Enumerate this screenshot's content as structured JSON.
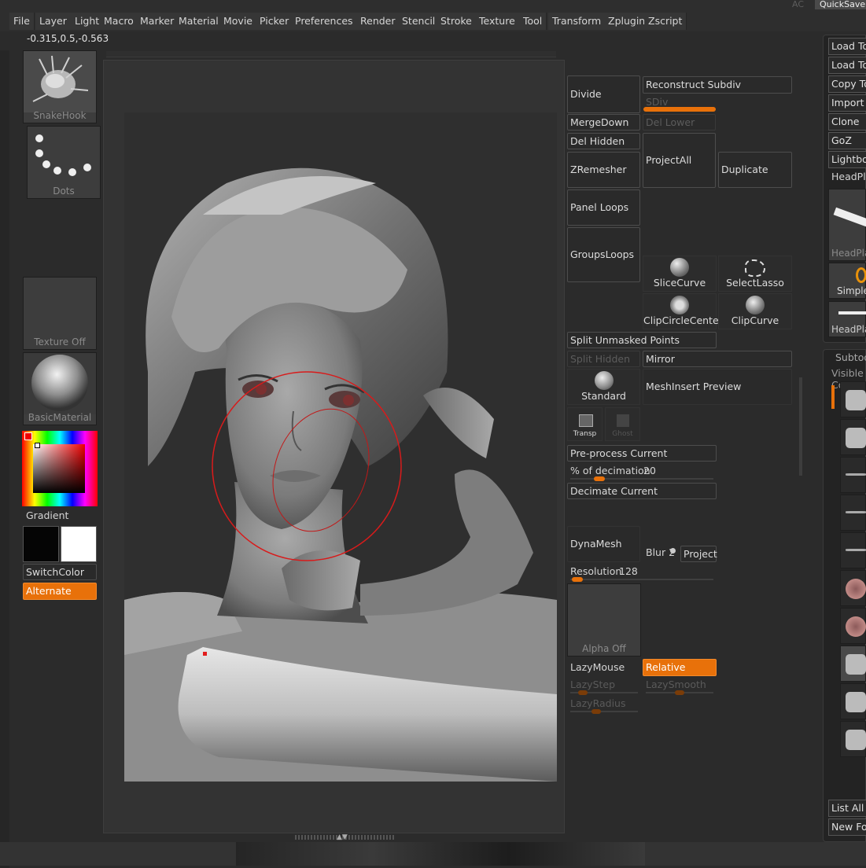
{
  "menu": [
    "File",
    "Layer",
    "Light",
    "Macro",
    "Marker",
    "Material",
    "Movie",
    "Picker",
    "Preferences",
    "Render",
    "Stencil",
    "Stroke",
    "Texture",
    "Tool",
    "Transform",
    "Zplugin",
    "Zscript"
  ],
  "top_right": {
    "ac": "AC",
    "quicksave": "QuickSave"
  },
  "coords": "-0.315,0.5,-0.563",
  "left": {
    "brush": "SnakeHook",
    "stroke": "Dots",
    "texture": "Texture Off",
    "material": "BasicMaterial",
    "gradient": "Gradient",
    "switchcolor": "SwitchColor",
    "alternate": "Alternate"
  },
  "geometry": {
    "divide": "Divide",
    "reconstruct": "Reconstruct Subdiv",
    "sdiv": "SDiv",
    "mergedown": "MergeDown",
    "del_lower": "Del Lower",
    "del_hidden": "Del Hidden",
    "zremesher": "ZRemesher",
    "projectall": "ProjectAll",
    "duplicate": "Duplicate",
    "panel_loops": "Panel Loops",
    "groups_loops": "GroupsLoops",
    "slicecurve": "SliceCurve",
    "selectlasso": "SelectLasso",
    "clipcircle": "ClipCircleCenter",
    "clipcurve": "ClipCurve",
    "split_unmasked": "Split Unmasked Points",
    "split_hidden": "Split Hidden",
    "mirror": "Mirror",
    "standard": "Standard",
    "meshinsert": "MeshInsert Preview",
    "transp": "Transp",
    "ghost": "Ghost",
    "preprocess": "Pre-process Current",
    "decimation_label": "% of decimation",
    "decimation_value": "20",
    "decimation_fraction": 0.2,
    "decimate": "Decimate Current",
    "dynamesh": "DynaMesh",
    "blur": "Blur 2",
    "project": "Project",
    "resolution_label": "Resolution",
    "resolution_value": "128",
    "alpha": "Alpha Off",
    "lazymouse": "LazyMouse",
    "relative": "Relative",
    "lazystep": "LazyStep",
    "lazysmooth": "LazySmooth",
    "lazyradius": "LazyRadius"
  },
  "right": {
    "buttons": [
      "Load Tool",
      "Load Tool",
      "Copy Tool",
      "Import",
      "Clone",
      "GoZ",
      "Lightbox"
    ],
    "headplane": "HeadPlane",
    "simple": "SimpleBrush",
    "headplane2": "HeadPlane",
    "subtool": "Subtool",
    "visible": "Visible Count",
    "list_all": "List All",
    "new_folder": "New Folder"
  },
  "colors": {
    "accent": "#e8710a",
    "background": "#2b2b2b"
  }
}
